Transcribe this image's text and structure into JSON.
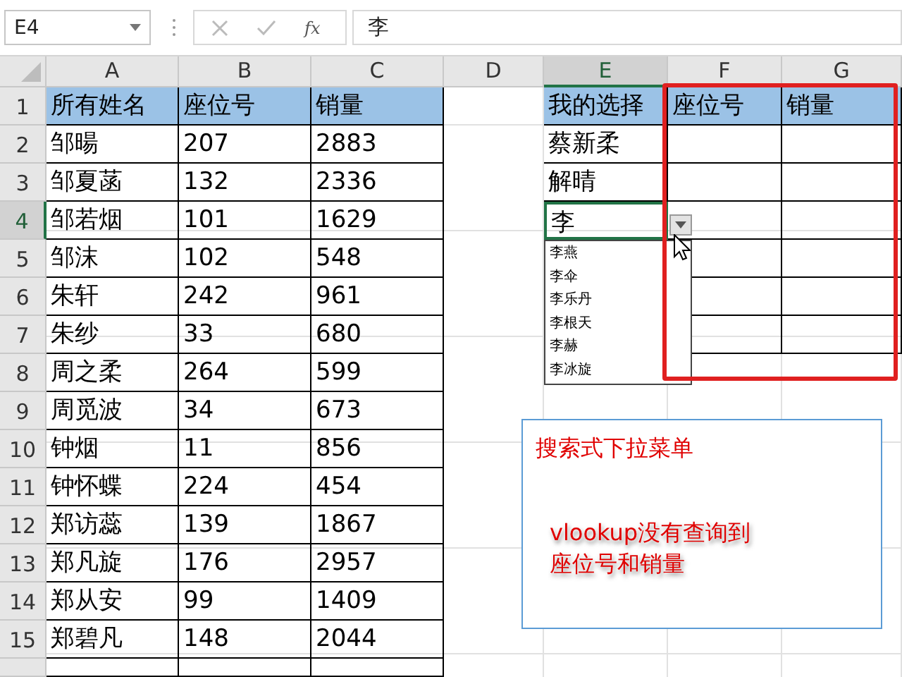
{
  "formula_bar": {
    "name_box": "E4",
    "function_label": "fx",
    "value": "李"
  },
  "columns": [
    {
      "label": "A",
      "selected": false
    },
    {
      "label": "B",
      "selected": false
    },
    {
      "label": "C",
      "selected": false
    },
    {
      "label": "D",
      "selected": false
    },
    {
      "label": "E",
      "selected": true
    },
    {
      "label": "F",
      "selected": false
    },
    {
      "label": "G",
      "selected": false
    }
  ],
  "rows": [
    {
      "number": "1",
      "selected": false,
      "kind": "header",
      "cells": {
        "A": "所有姓名",
        "B": "座位号",
        "C": "销量",
        "E": "我的选择",
        "F": "座位号",
        "G": "销量"
      }
    },
    {
      "number": "2",
      "selected": false,
      "kind": "data",
      "cells": {
        "A": "邹暘",
        "B": "207",
        "C": "2883",
        "E": "蔡新柔"
      }
    },
    {
      "number": "3",
      "selected": false,
      "kind": "data",
      "cells": {
        "A": "邹夏菡",
        "B": "132",
        "C": "2336",
        "E": "解晴"
      }
    },
    {
      "number": "4",
      "selected": true,
      "kind": "data",
      "cells": {
        "A": "邹若烟",
        "B": "101",
        "C": "1629",
        "E": "李"
      }
    },
    {
      "number": "5",
      "selected": false,
      "kind": "data",
      "cells": {
        "A": "邹沫",
        "B": "102",
        "C": "548"
      }
    },
    {
      "number": "6",
      "selected": false,
      "kind": "data",
      "cells": {
        "A": "朱轩",
        "B": "242",
        "C": "961"
      }
    },
    {
      "number": "7",
      "selected": false,
      "kind": "data",
      "cells": {
        "A": "朱纱",
        "B": "33",
        "C": "680"
      }
    },
    {
      "number": "8",
      "selected": false,
      "kind": "data",
      "cells": {
        "A": "周之柔",
        "B": "264",
        "C": "599"
      }
    },
    {
      "number": "9",
      "selected": false,
      "kind": "data",
      "cells": {
        "A": "周觅波",
        "B": "34",
        "C": "673"
      }
    },
    {
      "number": "10",
      "selected": false,
      "kind": "data",
      "cells": {
        "A": "钟烟",
        "B": "11",
        "C": "856"
      }
    },
    {
      "number": "11",
      "selected": false,
      "kind": "data",
      "cells": {
        "A": "钟怀蝶",
        "B": "224",
        "C": "454"
      }
    },
    {
      "number": "12",
      "selected": false,
      "kind": "data",
      "cells": {
        "A": "郑访蕊",
        "B": "139",
        "C": "1867"
      }
    },
    {
      "number": "13",
      "selected": false,
      "kind": "data",
      "cells": {
        "A": "郑凡旋",
        "B": "176",
        "C": "2957"
      }
    },
    {
      "number": "14",
      "selected": false,
      "kind": "data",
      "cells": {
        "A": "郑从安",
        "B": "99",
        "C": "1409"
      }
    },
    {
      "number": "15",
      "selected": false,
      "kind": "data",
      "cells": {
        "A": "郑碧凡",
        "B": "148",
        "C": "2044"
      }
    }
  ],
  "dropdown": {
    "items": [
      "李燕",
      "李伞",
      "李乐丹",
      "李根天",
      "李赫",
      "李冰旋"
    ]
  },
  "note_box": {
    "title": "搜索式下拉菜单",
    "callout": "vlookup没有查询到座位号和销量"
  }
}
